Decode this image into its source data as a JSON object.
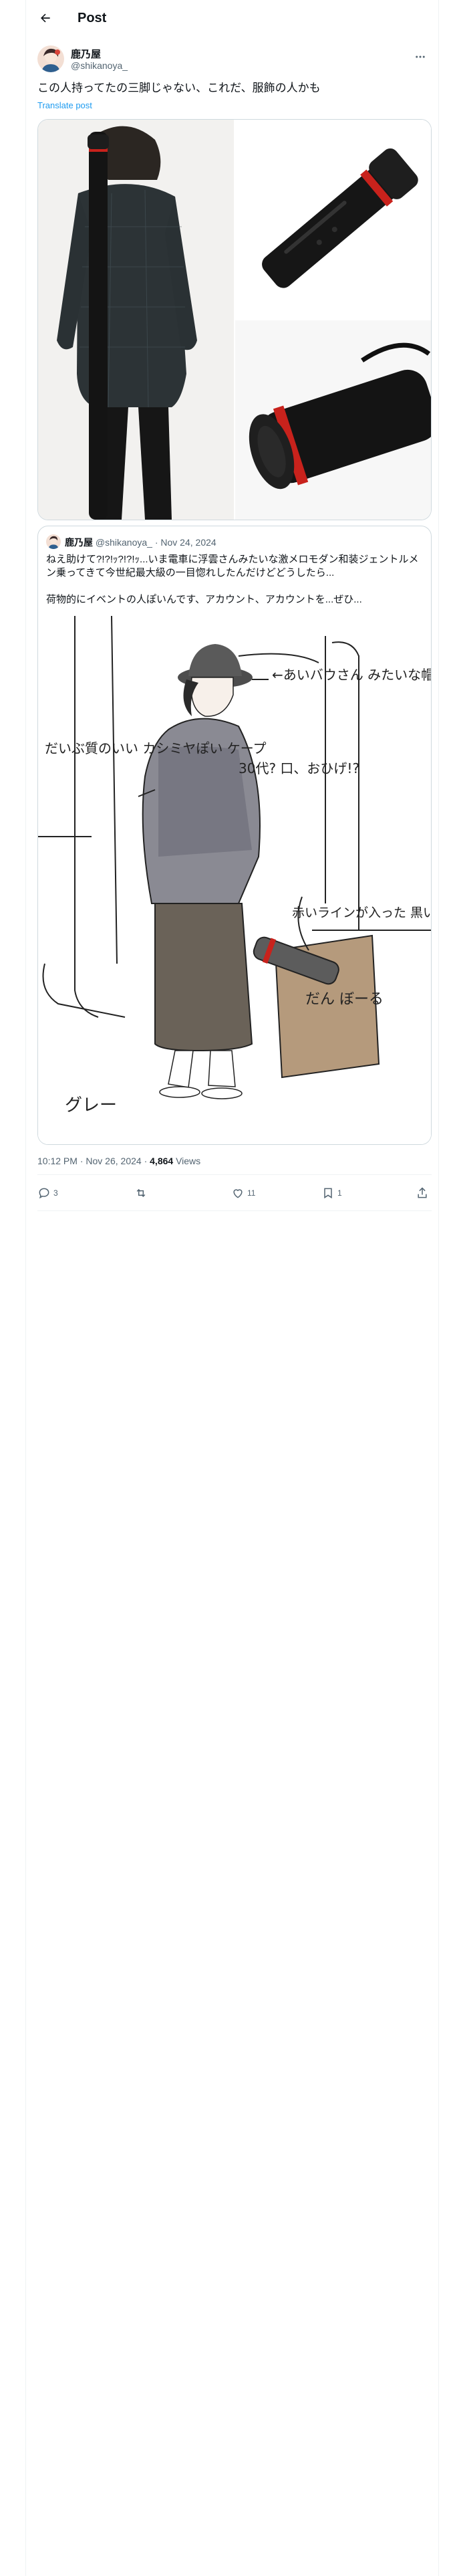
{
  "header": {
    "title": "Post"
  },
  "author": {
    "name": "鹿乃屋",
    "handle": "@shikanoya_"
  },
  "post": {
    "text": "この人持ってたの三脚じゃない、これだ、服飾の人かも",
    "translate_label": "Translate post"
  },
  "quote": {
    "name": "鹿乃屋",
    "handle": "@shikanoya_",
    "separator": "·",
    "date": "Nov 24, 2024",
    "text": "ねえ助けて?!?!ｯ?!?!ｯ...いま電車に浮雲さんみたいな激メロモダン和装ジェントルメン乗ってきて今世紀最大級の一目惚れしたんだけどどうしたら...",
    "text2": "荷物的にイベントの人ぽいんです、アカウント、アカウントを...ぜひ...",
    "sketch_notes": {
      "hat": "←あいバウさん みたいな帽子",
      "coat": "だいぶ質のいい カシミヤぽい ケープ",
      "age": "30代? 口、おひげ!?",
      "tube": "赤いラインが入った 黒い筒(三脚)",
      "bag": "だん ぼーる",
      "pants": "グレー"
    }
  },
  "meta": {
    "time": "10:12 PM",
    "separator": "·",
    "date": "Nov 26, 2024",
    "views_count": "4,864",
    "views_label": "Views"
  },
  "actions": {
    "replies": "3",
    "likes": "11",
    "bookmarks": "1"
  },
  "colors": {
    "accent": "#1d9bf0",
    "tube_red": "#d0261f",
    "muted": "#536471"
  }
}
